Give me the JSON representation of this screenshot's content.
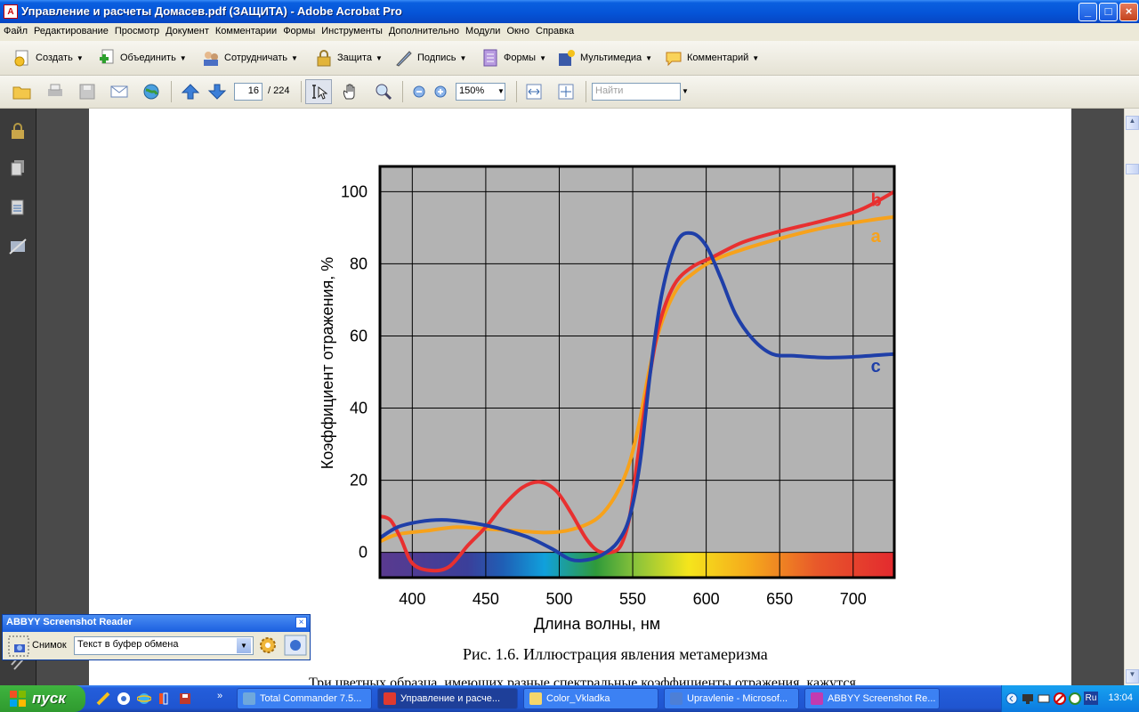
{
  "window": {
    "title": "Управление и расчеты Домасев.pdf (ЗАЩИТА) - Adobe Acrobat Pro",
    "controls": [
      "_",
      "□",
      "×"
    ]
  },
  "menu": [
    "Файл",
    "Редактирование",
    "Просмотр",
    "Документ",
    "Комментарии",
    "Формы",
    "Инструменты",
    "Дополнительно",
    "Модули",
    "Окно",
    "Справка"
  ],
  "toolbar1": {
    "items": [
      {
        "label": "Создать",
        "icon": "create-icon"
      },
      {
        "label": "Объединить",
        "icon": "combine-icon"
      },
      {
        "label": "Сотрудничать",
        "icon": "collaborate-icon"
      },
      {
        "label": "Защита",
        "icon": "lock-icon"
      },
      {
        "label": "Подпись",
        "icon": "pen-icon"
      },
      {
        "label": "Формы",
        "icon": "form-icon"
      },
      {
        "label": "Мультимедиа",
        "icon": "multimedia-icon"
      },
      {
        "label": "Комментарий",
        "icon": "comment-icon"
      }
    ]
  },
  "toolbar2": {
    "page_current": "16",
    "page_total": "/ 224",
    "zoom": "150%",
    "find_placeholder": "Найти"
  },
  "figure": {
    "caption": "Рис. 1.6. Иллюстрация явления метамеризма",
    "body_text": "Три цветных образца, имеющих разные спектральные коэффициенты отражения, кажутся"
  },
  "chart_data": {
    "type": "line",
    "xlabel": "Длина волны, нм",
    "ylabel": "Коэффициент отражения, %",
    "xlim": [
      378,
      728
    ],
    "ylim": [
      -7,
      107
    ],
    "xticks": [
      400,
      450,
      500,
      550,
      600,
      650,
      700
    ],
    "yticks": [
      0,
      20,
      40,
      60,
      80,
      100
    ],
    "grid": true,
    "background": "#b3b3b3",
    "series": [
      {
        "name": "a",
        "color": "#f7a21b",
        "points": [
          [
            378,
            3
          ],
          [
            390,
            5
          ],
          [
            410,
            6
          ],
          [
            430,
            7
          ],
          [
            450,
            6.5
          ],
          [
            470,
            6
          ],
          [
            490,
            5.5
          ],
          [
            505,
            6
          ],
          [
            520,
            8
          ],
          [
            530,
            11
          ],
          [
            540,
            17
          ],
          [
            548,
            25
          ],
          [
            555,
            37
          ],
          [
            562,
            52
          ],
          [
            570,
            64
          ],
          [
            580,
            73
          ],
          [
            590,
            77
          ],
          [
            605,
            81
          ],
          [
            625,
            84
          ],
          [
            650,
            87
          ],
          [
            680,
            90
          ],
          [
            710,
            92
          ],
          [
            728,
            93
          ]
        ]
      },
      {
        "name": "b",
        "color": "#e83030",
        "points": [
          [
            378,
            10
          ],
          [
            385,
            9
          ],
          [
            392,
            4
          ],
          [
            400,
            -3
          ],
          [
            412,
            -5
          ],
          [
            425,
            -4
          ],
          [
            438,
            2
          ],
          [
            450,
            7
          ],
          [
            462,
            13
          ],
          [
            475,
            18
          ],
          [
            487,
            19.5
          ],
          [
            498,
            17
          ],
          [
            508,
            11
          ],
          [
            518,
            4
          ],
          [
            526,
            0.5
          ],
          [
            535,
            0
          ],
          [
            542,
            2
          ],
          [
            548,
            10
          ],
          [
            553,
            25
          ],
          [
            560,
            45
          ],
          [
            568,
            63
          ],
          [
            578,
            74
          ],
          [
            590,
            79
          ],
          [
            605,
            82
          ],
          [
            625,
            86
          ],
          [
            650,
            89
          ],
          [
            680,
            92
          ],
          [
            705,
            95
          ],
          [
            728,
            100
          ]
        ]
      },
      {
        "name": "c",
        "color": "#1f3fa8",
        "points": [
          [
            378,
            4
          ],
          [
            390,
            7
          ],
          [
            405,
            8.5
          ],
          [
            420,
            9
          ],
          [
            435,
            8.5
          ],
          [
            450,
            7.5
          ],
          [
            465,
            6
          ],
          [
            480,
            4
          ],
          [
            495,
            1
          ],
          [
            508,
            -2
          ],
          [
            520,
            -2
          ],
          [
            530,
            -0.5
          ],
          [
            540,
            3
          ],
          [
            548,
            10
          ],
          [
            555,
            25
          ],
          [
            562,
            50
          ],
          [
            570,
            72
          ],
          [
            580,
            86
          ],
          [
            590,
            88.5
          ],
          [
            600,
            85
          ],
          [
            610,
            76
          ],
          [
            620,
            66
          ],
          [
            632,
            59
          ],
          [
            645,
            55
          ],
          [
            660,
            54.5
          ],
          [
            680,
            54
          ],
          [
            700,
            54.2
          ],
          [
            728,
            55
          ]
        ]
      }
    ],
    "spectrum_band": {
      "ymin": -7,
      "ymax": 0
    },
    "series_labels": [
      {
        "text": "b",
        "x": 712,
        "y": 96,
        "color": "#e83030"
      },
      {
        "text": "a",
        "x": 712,
        "y": 86,
        "color": "#f7a21b"
      },
      {
        "text": "c",
        "x": 712,
        "y": 50,
        "color": "#1f3fa8"
      }
    ]
  },
  "abbyy": {
    "title": "ABBYY Screenshot Reader",
    "snapshot_label": "Снимок",
    "mode": "Текст в буфер обмена"
  },
  "taskbar": {
    "start_label": "пуск",
    "tasks": [
      {
        "label": "Total Commander 7.5...",
        "color": "#6fa8dc"
      },
      {
        "label": "Управление и расче...",
        "color": "#e03a2f",
        "active": true
      },
      {
        "label": "Color_Vkladka",
        "color": "#f5d66b"
      },
      {
        "label": "Upravlenie - Microsof...",
        "color": "#4d7fd6"
      },
      {
        "label": "ABBYY Screenshot Re...",
        "color": "#c23bb0"
      }
    ],
    "tray": {
      "lang": "Ru",
      "time": "13:04"
    }
  }
}
